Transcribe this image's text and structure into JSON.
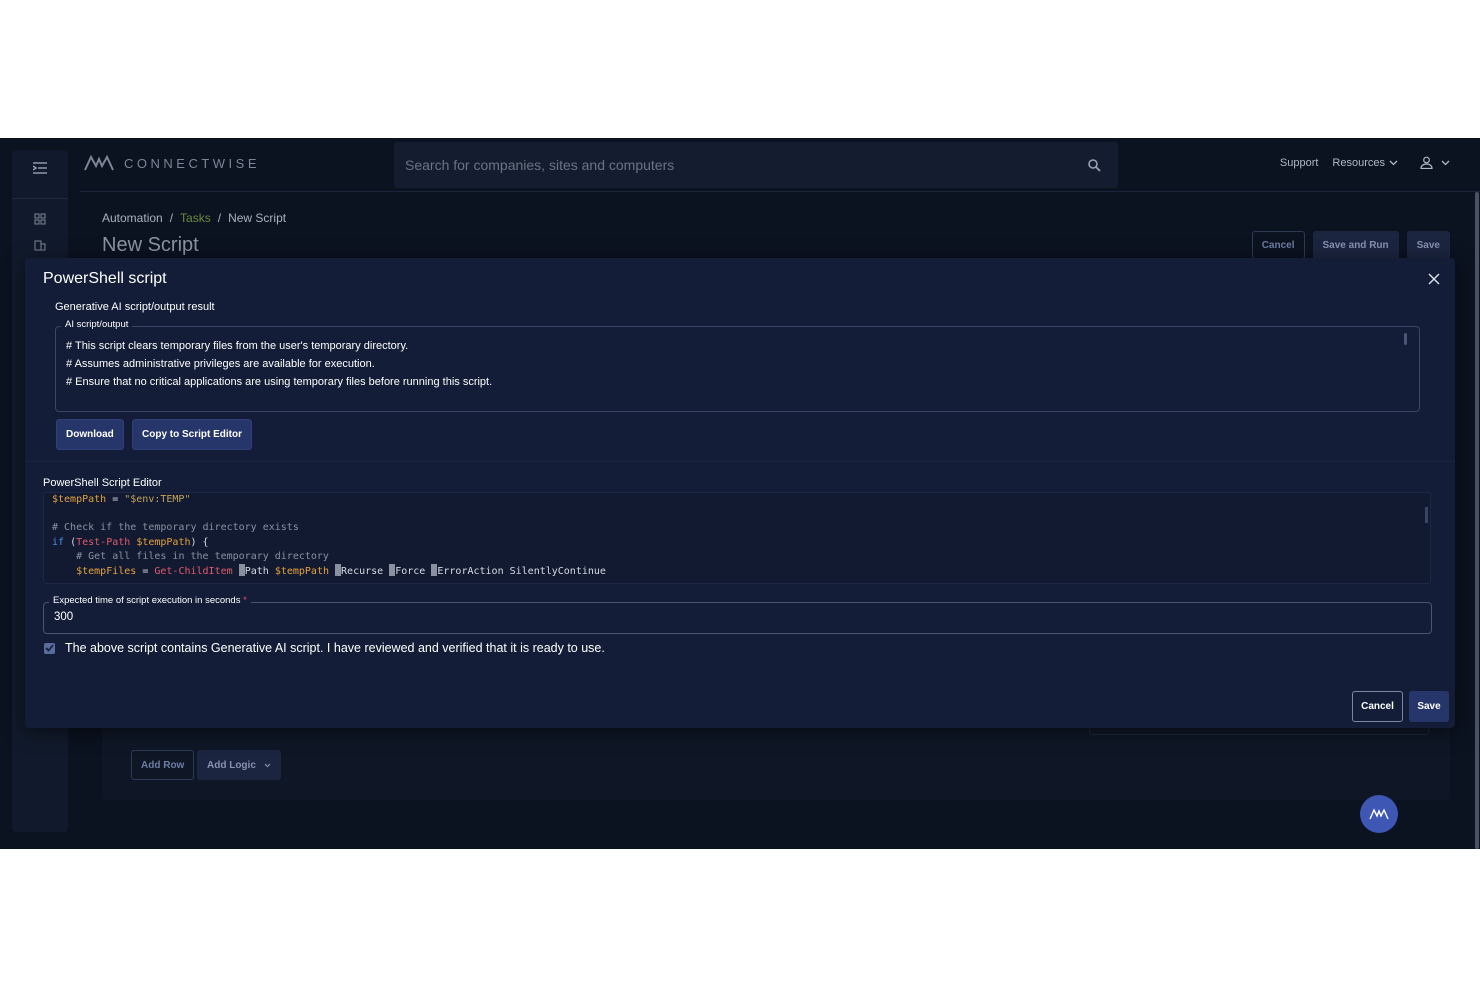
{
  "header": {
    "logo_text": "CONNECTWISE",
    "search_placeholder": "Search for companies, sites and computers",
    "support": "Support",
    "resources": "Resources"
  },
  "breadcrumb": [
    "Automation",
    "/",
    "Tasks",
    "/",
    "New Script"
  ],
  "page": {
    "title": "New Script",
    "actions": {
      "cancel": "Cancel",
      "save_and_run": "Save and Run",
      "save": "Save"
    },
    "add_row": "Add Row",
    "add_logic": "Add Logic"
  },
  "modal": {
    "title": "PowerShell script",
    "ai_section_label": "Generative AI script/output result",
    "ai_field_label": "AI script/output",
    "ai_lines": [
      "# This script clears temporary files from the user's temporary directory.",
      "# Assumes administrative privileges are available for execution.",
      "# Ensure that no critical applications are using temporary files before running this script."
    ],
    "download": "Download",
    "copy_to_editor": "Copy to Script Editor",
    "editor_label": "PowerShell Script Editor",
    "code": {
      "line1_var": "$tempPath",
      "line1_op": " = ",
      "line1_str": "\"$env:TEMP\"",
      "line3_comment": "# Check if the temporary directory exists",
      "line4_kw": "if",
      "line4_open": " (",
      "line4_fn": "Test-Path",
      "line4_var": "$tempPath",
      "line4_close": ") {",
      "line5_comment": "# Get all files in the temporary directory",
      "line6_var": "$tempFiles",
      "line6_op": " = ",
      "line6_fn": "Get-ChildItem",
      "line6_path": "Path",
      "line6_pathvar": "$tempPath",
      "line6_recurse": "Recurse",
      "line6_force": "Force",
      "line6_error": "ErrorAction SilentlyContinue"
    },
    "expected_time_label": "Expected time of script execution in seconds",
    "expected_time_required": "*",
    "expected_time_value": "300",
    "checkbox_checked": true,
    "checkbox_label": "The above script contains Generative AI script. I have reviewed and verified that it is ready to use.",
    "cancel": "Cancel",
    "save": "Save"
  },
  "colors": {
    "background": "#0b1220",
    "modal": "#131d37",
    "primary_button": "#27366a",
    "breadcrumb_link": "#6b8a3e",
    "fab": "#3e56b4"
  }
}
